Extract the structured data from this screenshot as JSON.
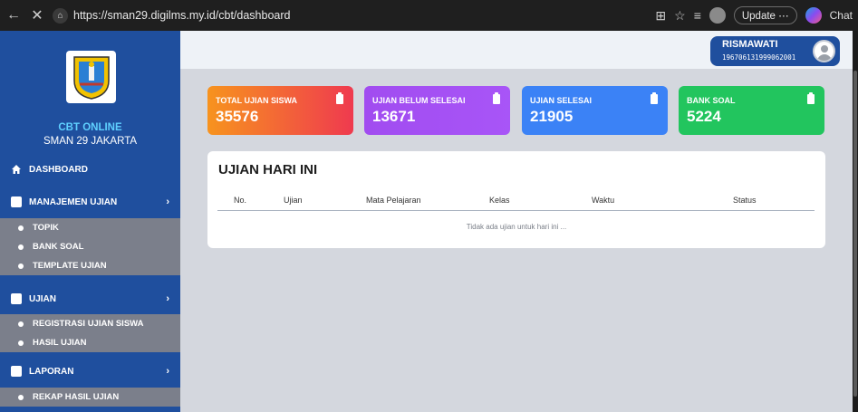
{
  "browser": {
    "url": "https://sman29.digilms.my.id/cbt/dashboard",
    "update_label": "Update ⋯",
    "chat_label": "Chat"
  },
  "sidebar": {
    "brand_line1": "CBT ONLINE",
    "brand_line2": "SMAN 29 JAKARTA",
    "logo_text": "JAKARTA",
    "items": [
      {
        "label": "DASHBOARD",
        "icon": "home-icon"
      },
      {
        "label": "MANAJEMEN UJIAN",
        "icon": "book-icon"
      },
      {
        "label": "UJIAN",
        "icon": "book-icon"
      },
      {
        "label": "LAPORAN",
        "icon": "book-icon"
      }
    ],
    "manajemen_sub": [
      "TOPIK",
      "BANK SOAL",
      "TEMPLATE UJIAN"
    ],
    "ujian_sub": [
      "REGISTRASI UJIAN SISWA",
      "HASIL UJIAN"
    ],
    "laporan_sub": [
      "REKAP HASIL UJIAN"
    ]
  },
  "user": {
    "name": "RISMAWATI",
    "id": "196706131999062001"
  },
  "cards": [
    {
      "title": "TOTAL UJIAN SISWA",
      "value": "35576",
      "color_from": "#f7931e",
      "color_to": "#ef3a4f"
    },
    {
      "title": "UJIAN BELUM SELESAI",
      "value": "13671",
      "color_from": "#a14cf0",
      "color_to": "#a855f7"
    },
    {
      "title": "UJIAN SELESAI",
      "value": "21905",
      "color_from": "#3b82f6",
      "color_to": "#3b82f6"
    },
    {
      "title": "BANK SOAL",
      "value": "5224",
      "color_from": "#22c55e",
      "color_to": "#22c55e"
    }
  ],
  "panel": {
    "title": "UJIAN HARI INI",
    "columns": [
      "No.",
      "Ujian",
      "Mata Pelajaran",
      "Kelas",
      "Waktu",
      "Status"
    ],
    "empty_text": "Tidak ada ujian untuk hari ini ..."
  }
}
